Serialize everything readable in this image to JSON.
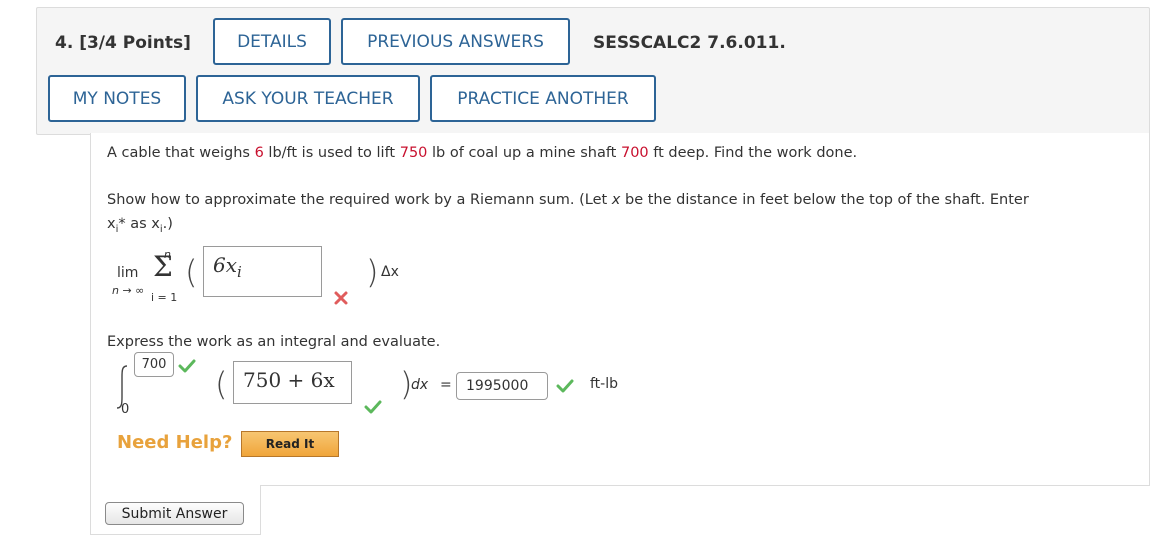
{
  "header": {
    "question_title": "4. [3/4 Points]",
    "question_id": "SESSCALC2 7.6.011.",
    "buttons": {
      "details": "DETAILS",
      "previous_answers": "PREVIOUS ANSWERS",
      "my_notes": "MY NOTES",
      "ask_teacher": "ASK YOUR TEACHER",
      "practice_another": "PRACTICE ANOTHER"
    },
    "button_color": "#2d6496"
  },
  "problem": {
    "part1_a": "A cable that weighs ",
    "weight": "6",
    "part1_b": " lb/ft is used to lift ",
    "load": "750",
    "part1_c": " lb of coal up a mine shaft ",
    "depth": "700",
    "part1_d": " ft deep. Find the work done.",
    "highlight_color": "#c8102e"
  },
  "riemann": {
    "instruction_line1_a": "Show how to approximate the required work by a Riemann sum. (Let ",
    "instruction_var": "x",
    "instruction_line1_b": " be the distance in feet below the top of the shaft. Enter",
    "instruction_line2_a": "x",
    "instruction_line2_sub": "i",
    "instruction_line2_b": "* as x",
    "instruction_line2_sub2": "i",
    "instruction_line2_c": ".)",
    "lim": "lim",
    "lim_sub": "n → ∞",
    "sum_top": "n",
    "sum_bottom": "i = 1",
    "sigma": "Σ",
    "answer": "6x",
    "answer_sub": "i",
    "delta": "Δx",
    "status": "incorrect"
  },
  "integral": {
    "instruction": "Express the work as an integral and evaluate.",
    "upper_limit": "700",
    "lower_limit": "0",
    "integrand": "750 + 6x",
    "dx": "dx",
    "equals": "=",
    "result": "1995000",
    "unit": "ft-lb",
    "status": "correct"
  },
  "help": {
    "label": "Need Help?",
    "read_it": "Read It"
  },
  "submit": {
    "label": "Submit Answer"
  },
  "colors": {
    "correct": "#5cb85c",
    "incorrect": "#e05c5c",
    "need_help": "#e8a23c"
  }
}
